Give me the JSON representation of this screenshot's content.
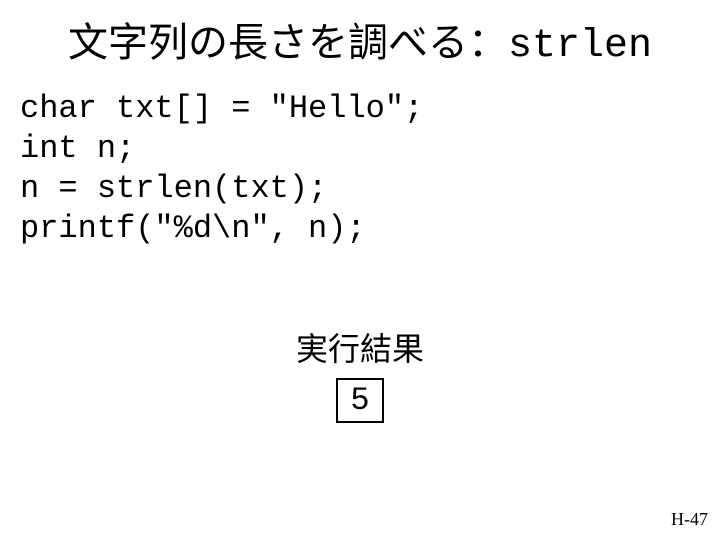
{
  "title": {
    "jp": "文字列の長さを調べる：",
    "mono": "strlen"
  },
  "code": {
    "line1": "char txt[] = \"Hello\";",
    "line2": "int n;",
    "line3": "n = strlen(txt);",
    "line4": "printf(\"%d\\n\", n);"
  },
  "result": {
    "label": "実行結果",
    "value": "5"
  },
  "page": "H-47"
}
